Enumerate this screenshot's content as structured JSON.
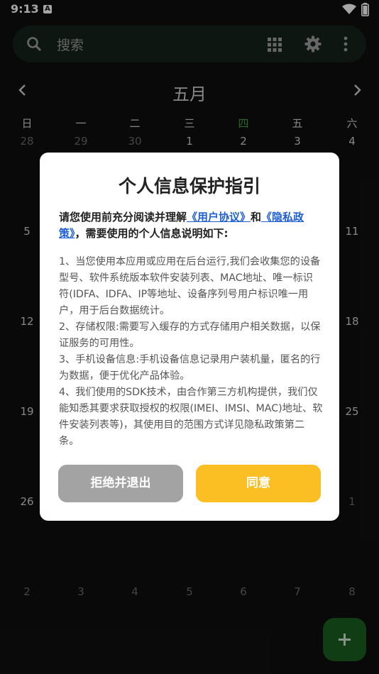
{
  "status_bar": {
    "time": "9:13",
    "notification_letter": "A"
  },
  "search": {
    "placeholder": "搜索"
  },
  "calendar": {
    "month_label": "五月",
    "weekdays": [
      "日",
      "一",
      "二",
      "三",
      "四",
      "五",
      "六"
    ],
    "today_weekday_index": 4,
    "rows": [
      [
        "28",
        "29",
        "30",
        "1",
        "2",
        "3",
        "4"
      ],
      [
        "5",
        "",
        "",
        "",
        "",
        "",
        "11"
      ],
      [
        "12",
        "",
        "",
        "",
        "",
        "",
        "18"
      ],
      [
        "19",
        "",
        "",
        "",
        "",
        "",
        "25"
      ],
      [
        "26",
        "",
        "",
        "",
        "",
        "",
        "1"
      ],
      [
        "2",
        "3",
        "4",
        "5",
        "6",
        "7",
        "8"
      ]
    ]
  },
  "dialog": {
    "title": "个人信息保护指引",
    "intro_prefix": "请您使用前充分阅读并理解",
    "user_agreement_link": "《用户协议》",
    "conjunction": "和",
    "privacy_policy_link": "《隐私政策》",
    "intro_suffix": "，需要使用的个人信息说明如下:",
    "paragraphs": [
      "1、当您使用本应用或应用在后台运行,我们会收集您的设备型号、软件系统版本软件安装列表、MAC地址、唯一标识符(IDFA、IDFA、IP等地址、设备序列号用户标识唯一用户，用于后台数据统计。",
      "2、存储权限:需要写入缓存的方式存储用户相关数据，以保证服务的可用性。",
      "3、手机设备信息:手机设备信息记录用户装机量，匿名的行为数据，便于优化产品体验。",
      "4、我们使用的SDK技术，由合作第三方机构提供，我们仅能知悉其要求获取授权的权限(IMEI、IMSI、MAC)地址、软件安装列表等)，其使用目的范围方式详见隐私政策第二条。"
    ],
    "reject_label": "拒绝并退出",
    "agree_label": "同意"
  },
  "colors": {
    "background": "#0f0f0f",
    "search_bg": "#16231b",
    "today_accent": "#43a047",
    "link": "#1e5fd6",
    "agree_button": "#fbbf24",
    "reject_button": "#a3a3a3",
    "fab": "#1b5e20"
  },
  "icons": [
    "search-icon",
    "grid-icon",
    "gear-icon",
    "more-vert-icon",
    "chevron-left-icon",
    "chevron-right-icon",
    "plus-icon",
    "wifi-icon",
    "battery-icon"
  ]
}
